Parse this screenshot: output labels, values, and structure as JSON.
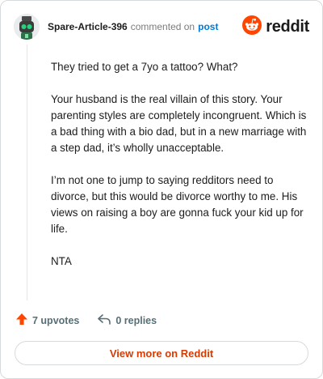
{
  "header": {
    "username": "Spare-Article-396",
    "action_text": "commented on",
    "post_link": "post",
    "brand": "reddit",
    "colors": {
      "brand": "#ff4500",
      "link": "#0079d3"
    }
  },
  "icons": {
    "avatar": "robot-avatar-icon",
    "brand": "reddit-logo-icon",
    "upvote": "upvote-arrow-icon",
    "reply": "reply-arrow-icon"
  },
  "comment": {
    "paragraphs": [
      "They tried to get a 7yo a tattoo? What?",
      "Your husband is the real villain of this story. Your parenting styles are completely incongruent. Which is a bad thing with a bio dad, but in a new marriage with a step dad, it’s wholly unacceptable.",
      "I’m not one to jump to saying redditors need to divorce, but this would be divorce worthy to me. His views on raising a boy are gonna fuck your kid up for life.",
      "NTA"
    ]
  },
  "actions": {
    "upvotes": "7 upvotes",
    "replies": "0 replies"
  },
  "footer": {
    "view_more": "View more on Reddit",
    "color": "#d93a00"
  }
}
